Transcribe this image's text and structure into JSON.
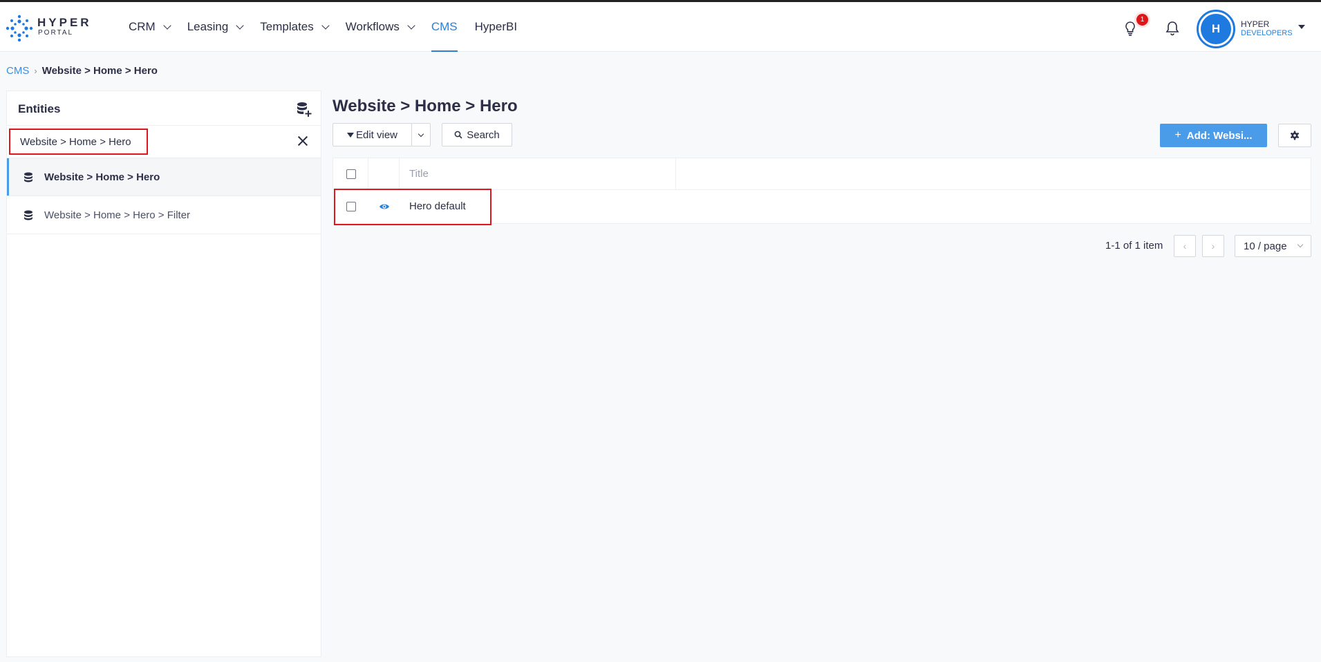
{
  "header": {
    "logo": {
      "line1": "HYPER",
      "line2": "PORTAL"
    },
    "nav": [
      {
        "label": "CRM",
        "dropdown": true
      },
      {
        "label": "Leasing",
        "dropdown": true
      },
      {
        "label": "Templates",
        "dropdown": true
      },
      {
        "label": "Workflows",
        "dropdown": true
      },
      {
        "label": "CMS",
        "dropdown": false,
        "active": true
      },
      {
        "label": "HyperBI",
        "dropdown": false
      }
    ],
    "notification_badge": "1",
    "avatar_initial": "H",
    "company": {
      "line1": "HYPER",
      "line2": "DEVELOPERS"
    },
    "accent_color": "#2b7fd6"
  },
  "breadcrumb": {
    "root": "CMS",
    "separator": "›",
    "current": "Website > Home > Hero"
  },
  "entities": {
    "title": "Entities",
    "search_value": "Website > Home > Hero",
    "items": [
      {
        "label": "Website > Home > Hero",
        "active": true
      },
      {
        "label": "Website > Home > Hero > Filter",
        "active": false
      }
    ]
  },
  "main": {
    "title": "Website > Home > Hero",
    "toolbar": {
      "edit_view": "Edit view",
      "search": "Search",
      "add": "Add: Websi..."
    },
    "table": {
      "columns": [
        "Title"
      ],
      "rows": [
        {
          "title": "Hero default"
        }
      ]
    },
    "pagination": {
      "summary": "1-1 of 1 item",
      "page_size": "10 / page"
    }
  },
  "colors": {
    "highlight_border": "#e0161e",
    "primary_button": "#4a9be8"
  }
}
